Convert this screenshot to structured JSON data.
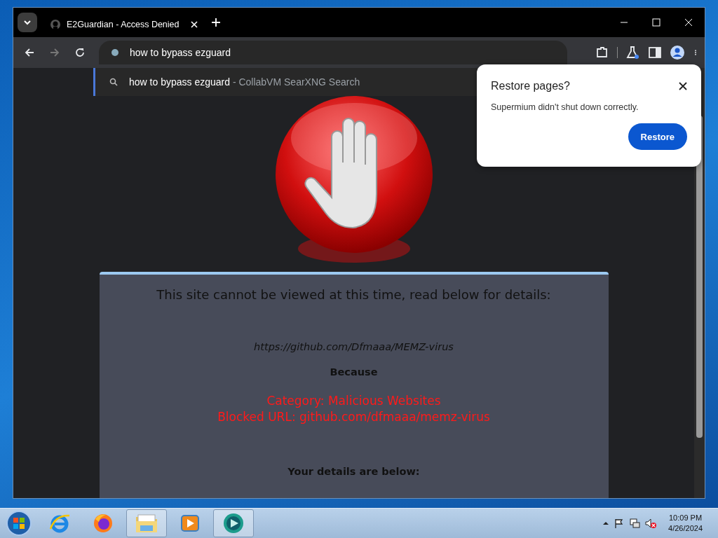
{
  "browser": {
    "tab": {
      "title": "E2Guardian - Access Denied"
    },
    "omnibox": {
      "value": "how to bypass ezguard"
    },
    "suggestion": {
      "query": "how to bypass ezguard",
      "source": "- CollabVM SearXNG Search"
    }
  },
  "restore_dialog": {
    "title": "Restore pages?",
    "message": "Supermium didn't shut down correctly.",
    "button": "Restore"
  },
  "page": {
    "heading": "This site cannot be viewed at this time, read below for details:",
    "url": "https://github.com/Dfmaaa/MEMZ-virus",
    "because": "Because",
    "reasons": [
      "Category: Malicious Websites",
      "Blocked URL: github.com/dfmaaa/memz-virus"
    ],
    "details_heading": "Your details are below:"
  },
  "taskbar": {
    "apps": [
      {
        "kind": "ie",
        "selected": false
      },
      {
        "kind": "firefox",
        "selected": false
      },
      {
        "kind": "explorer",
        "selected": true
      },
      {
        "kind": "media",
        "selected": false
      },
      {
        "kind": "app",
        "selected": true
      }
    ],
    "clock": {
      "time": "10:09 PM",
      "date": "4/26/2024"
    }
  }
}
